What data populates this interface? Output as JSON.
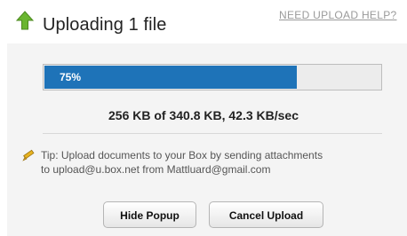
{
  "header": {
    "title": "Uploading 1 file",
    "help_link": "NEED UPLOAD HELP?",
    "icon": "green-up-arrow-icon"
  },
  "progress": {
    "percent_label": "75%",
    "fraction": 0.75,
    "transfer_status": "256 KB of 340.8 KB, 42.3 KB/sec"
  },
  "tip": {
    "icon": "pencil-icon",
    "line1": "Tip: Upload documents to your Box by sending attachments",
    "line2": "to upload@u.box.net from Mattluard@gmail.com"
  },
  "buttons": {
    "hide_popup": "Hide Popup",
    "cancel_upload": "Cancel Upload"
  },
  "colors": {
    "progress_fill": "#1e73b8",
    "arrow": "#6ab630"
  }
}
